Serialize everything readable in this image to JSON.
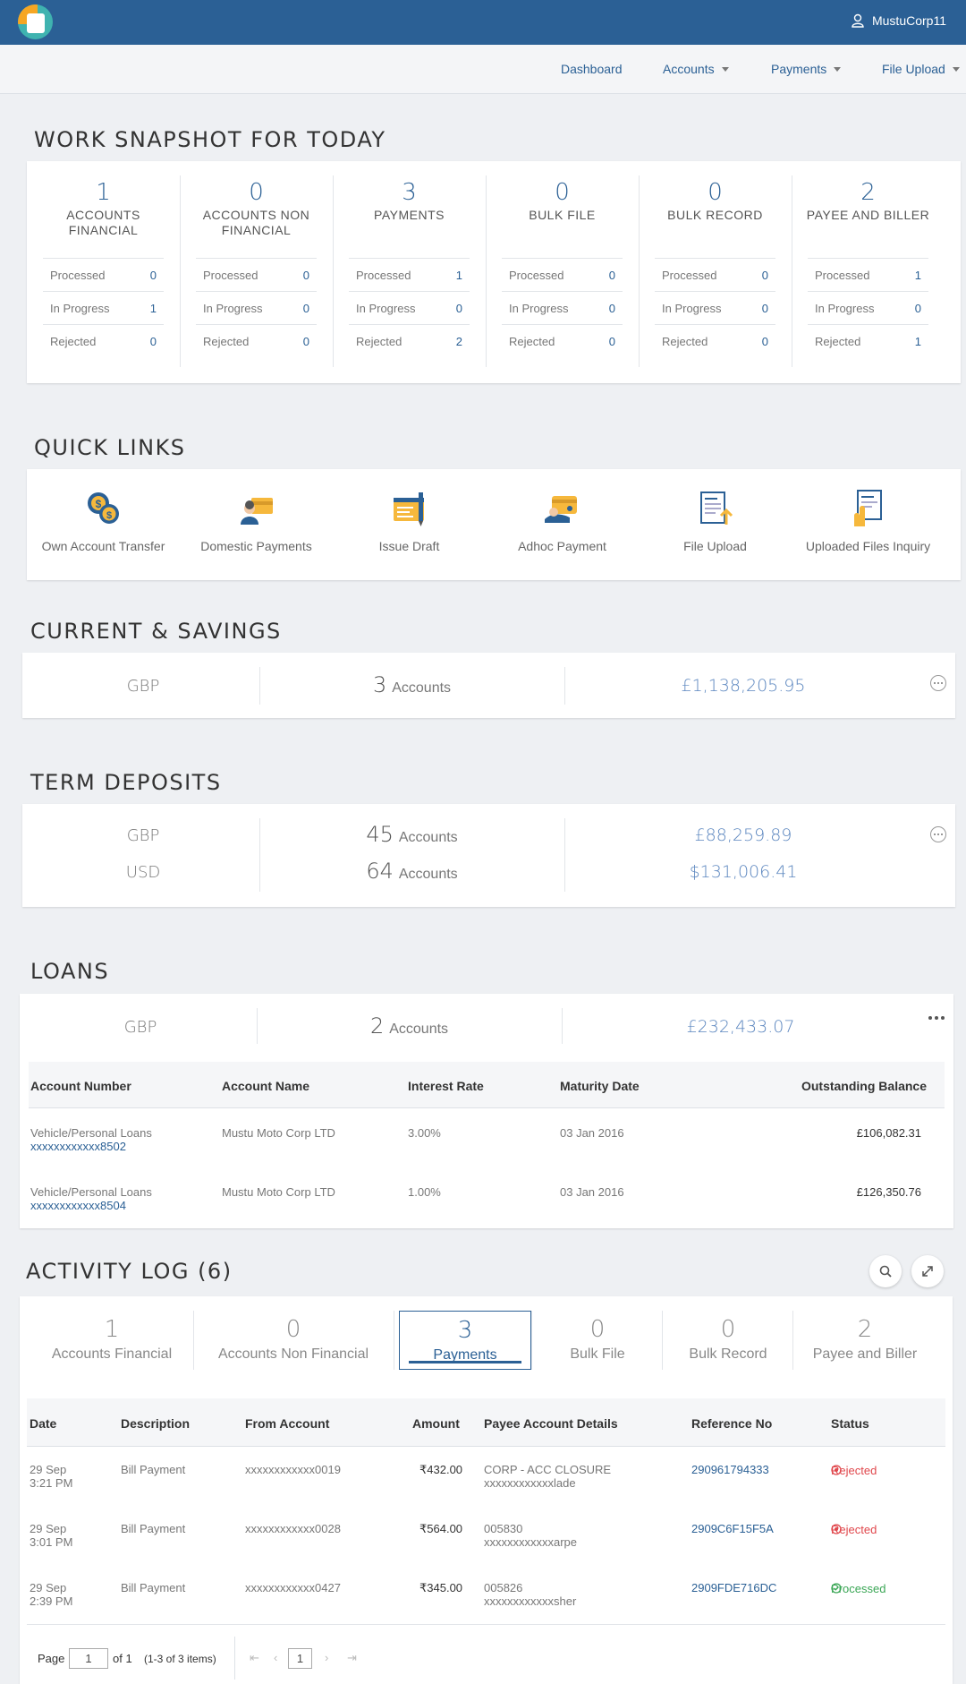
{
  "header": {
    "user_name": "MustuCorp11"
  },
  "nav": {
    "items": [
      {
        "label": "Dashboard",
        "has_dropdown": false
      },
      {
        "label": "Accounts",
        "has_dropdown": true
      },
      {
        "label": "Payments",
        "has_dropdown": true
      },
      {
        "label": "File Upload",
        "has_dropdown": true
      }
    ]
  },
  "work_snapshot": {
    "title": "WORK SNAPSHOT FOR TODAY",
    "row_labels": {
      "processed": "Processed",
      "in_progress": "In Progress",
      "rejected": "Rejected"
    },
    "columns": [
      {
        "count": "1",
        "label": "ACCOUNTS FINANCIAL",
        "processed": "0",
        "in_progress": "1",
        "rejected": "0"
      },
      {
        "count": "0",
        "label": "ACCOUNTS NON FINANCIAL",
        "processed": "0",
        "in_progress": "0",
        "rejected": "0"
      },
      {
        "count": "3",
        "label": "PAYMENTS",
        "processed": "1",
        "in_progress": "0",
        "rejected": "2"
      },
      {
        "count": "0",
        "label": "BULK FILE",
        "processed": "0",
        "in_progress": "0",
        "rejected": "0"
      },
      {
        "count": "0",
        "label": "BULK RECORD",
        "processed": "0",
        "in_progress": "0",
        "rejected": "0"
      },
      {
        "count": "2",
        "label": "PAYEE AND BILLER",
        "processed": "1",
        "in_progress": "0",
        "rejected": "1"
      }
    ]
  },
  "quick_links": {
    "title": "QUICK LINKS",
    "items": [
      {
        "label": "Own Account Transfer",
        "icon": "coins-exchange-icon"
      },
      {
        "label": "Domestic Payments",
        "icon": "user-wallet-icon"
      },
      {
        "label": "Issue Draft",
        "icon": "cheque-pen-icon"
      },
      {
        "label": "Adhoc Payment",
        "icon": "wallet-hand-icon"
      },
      {
        "label": "File Upload",
        "icon": "file-upload-icon"
      },
      {
        "label": "Uploaded Files Inquiry",
        "icon": "file-inquiry-icon"
      }
    ]
  },
  "current_savings": {
    "title": "CURRENT & SAVINGS",
    "rows": [
      {
        "currency": "GBP",
        "count": "3",
        "accounts_label": "Accounts",
        "amount": "£1,138,205.95"
      }
    ]
  },
  "term_deposits": {
    "title": "TERM DEPOSITS",
    "rows": [
      {
        "currency": "GBP",
        "count": "45",
        "accounts_label": "Accounts",
        "amount": "£88,259.89"
      },
      {
        "currency": "USD",
        "count": "64",
        "accounts_label": "Accounts",
        "amount": "$131,006.41"
      }
    ]
  },
  "loans": {
    "title": "LOANS",
    "summary": {
      "currency": "GBP",
      "count": "2",
      "accounts_label": "Accounts",
      "amount": "£232,433.07"
    },
    "columns": [
      "Account Number",
      "Account Name",
      "Interest Rate",
      "Maturity Date",
      "Outstanding Balance"
    ],
    "rows": [
      {
        "type": "Vehicle/Personal Loans",
        "number": "xxxxxxxxxxxx8502",
        "name": "Mustu Moto Corp LTD",
        "rate": "3.00%",
        "maturity": "03 Jan 2016",
        "balance": "£106,082.31"
      },
      {
        "type": "Vehicle/Personal Loans",
        "number": "xxxxxxxxxxxx8504",
        "name": "Mustu Moto Corp LTD",
        "rate": "1.00%",
        "maturity": "03 Jan 2016",
        "balance": "£126,350.76"
      }
    ]
  },
  "activity_log": {
    "title": "ACTIVITY LOG (6)",
    "tabs": [
      {
        "count": "1",
        "label": "Accounts Financial"
      },
      {
        "count": "0",
        "label": "Accounts Non Financial"
      },
      {
        "count": "3",
        "label": "Payments",
        "active": true
      },
      {
        "count": "0",
        "label": "Bulk File"
      },
      {
        "count": "0",
        "label": "Bulk Record"
      },
      {
        "count": "2",
        "label": "Payee and Biller"
      }
    ],
    "columns": [
      "Date",
      "Description",
      "From Account",
      "Amount",
      "Payee Account Details",
      "Reference No",
      "Status"
    ],
    "rows": [
      {
        "date": "29 Sep",
        "time": "3:21 PM",
        "description": "Bill Payment",
        "from": "xxxxxxxxxxxx0019",
        "amount": "₹432.00",
        "payee1": "CORP - ACC CLOSURE",
        "payee2": "xxxxxxxxxxxxlade",
        "ref": "290961794333",
        "status": "Rejected"
      },
      {
        "date": "29 Sep",
        "time": "3:01 PM",
        "description": "Bill Payment",
        "from": "xxxxxxxxxxxx0028",
        "amount": "₹564.00",
        "payee1": "005830",
        "payee2": "xxxxxxxxxxxxarpe",
        "ref": "2909C6F15F5A",
        "status": "Rejected"
      },
      {
        "date": "29 Sep",
        "time": "2:39 PM",
        "description": "Bill Payment",
        "from": "xxxxxxxxxxxx0427",
        "amount": "₹345.00",
        "payee1": "005826",
        "payee2": "xxxxxxxxxxxxsher",
        "ref": "2909FDE716DC",
        "status": "Processed"
      }
    ],
    "pager": {
      "page_label": "Page",
      "page_value": "1",
      "of_label": "of 1",
      "items_label": "(1-3 of 3 items)",
      "current_page": "1"
    }
  },
  "colors": {
    "header_bg": "#2b6095",
    "accent": "#2b6095",
    "amount": "#5b86bf",
    "rejected": "#e0474c",
    "processed": "#3aa655"
  }
}
